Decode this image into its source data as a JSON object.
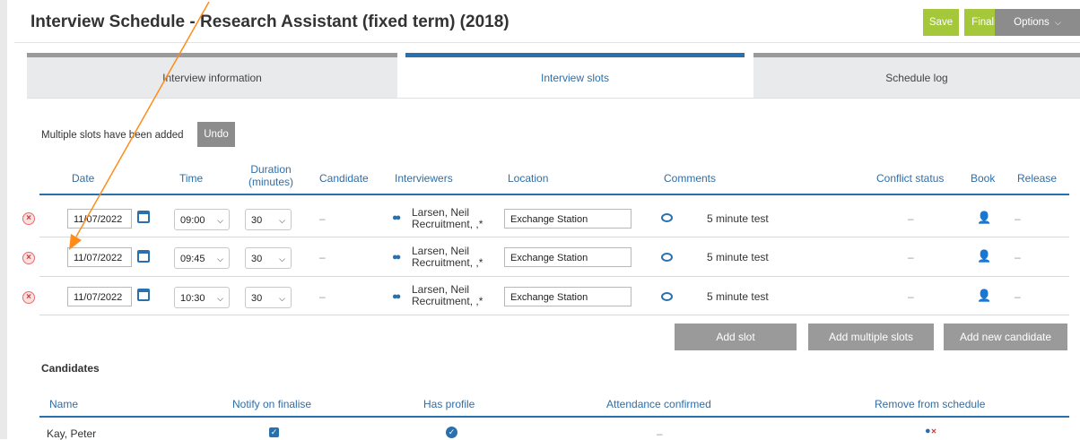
{
  "page": {
    "title": "Interview Schedule - Research Assistant (fixed term) (2018)"
  },
  "toolbar": {
    "save_label": "Save",
    "finalise_label": "Finalise",
    "options_label": "Options",
    "options_icon": "chevron-down-icon"
  },
  "tabs": [
    {
      "label": "Interview information",
      "active": false
    },
    {
      "label": "Interview slots",
      "active": true
    },
    {
      "label": "Schedule log",
      "active": false
    }
  ],
  "notice": {
    "text": "Multiple slots have been added",
    "undo_label": "Undo"
  },
  "slots_table": {
    "headers": {
      "date": "Date",
      "time": "Time",
      "duration_line1": "Duration",
      "duration_line2": "(minutes)",
      "candidate": "Candidate",
      "interviewers": "Interviewers",
      "location": "Location",
      "comments": "Comments",
      "conflict": "Conflict status",
      "book": "Book",
      "release": "Release"
    },
    "rows": [
      {
        "date": "11/07/2022",
        "time": "09:00",
        "duration": "30",
        "candidate": "–",
        "interviewer_line1": "Larsen, Neil",
        "interviewer_line2": "Recruitment, ,*",
        "location": "Exchange Station",
        "comment": "5 minute test",
        "conflict": "–",
        "release": "–"
      },
      {
        "date": "11/07/2022",
        "time": "09:45",
        "duration": "30",
        "candidate": "–",
        "interviewer_line1": "Larsen, Neil",
        "interviewer_line2": "Recruitment, ,*",
        "location": "Exchange Station",
        "comment": "5 minute test",
        "conflict": "–",
        "release": "–"
      },
      {
        "date": "11/07/2022",
        "time": "10:30",
        "duration": "30",
        "candidate": "–",
        "interviewer_line1": "Larsen, Neil",
        "interviewer_line2": "Recruitment, ,*",
        "location": "Exchange Station",
        "comment": "5 minute test",
        "conflict": "–",
        "release": "–"
      }
    ]
  },
  "actions": {
    "add_slot": "Add slot",
    "add_multiple_slots": "Add multiple slots",
    "add_new_candidate": "Add new candidate"
  },
  "candidates": {
    "title": "Candidates",
    "headers": {
      "name": "Name",
      "notify": "Notify on finalise",
      "profile": "Has profile",
      "attendance": "Attendance confirmed",
      "remove": "Remove from schedule"
    },
    "rows": [
      {
        "name": "Kay, Peter",
        "notify": true,
        "has_profile": true,
        "attendance": "–"
      }
    ]
  },
  "colors": {
    "accent_blue": "#2a6fae",
    "save_green": "#a4c83a",
    "options_gray": "#8c8c8c",
    "annotation_arrow": "#ff8c1a"
  }
}
